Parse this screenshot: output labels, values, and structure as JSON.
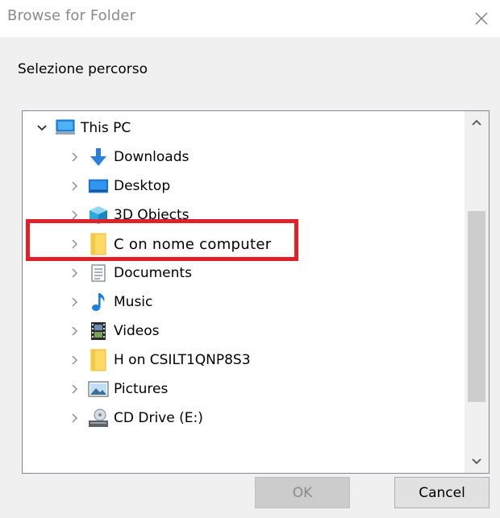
{
  "window": {
    "title": "Browse for Folder",
    "close_icon": "close-icon"
  },
  "dialog": {
    "instruction": "Selezione percorso"
  },
  "tree": {
    "root": {
      "label": "This PC",
      "icon": "computer-icon",
      "expanded": true
    },
    "items": [
      {
        "label": "Downloads",
        "icon": "downloads-arrow-icon"
      },
      {
        "label": "Desktop",
        "icon": "desktop-icon"
      },
      {
        "label": "3D Objects",
        "icon": "3d-objects-icon"
      },
      {
        "label": "C on nome computer",
        "icon": "folder-icon",
        "highlighted": true
      },
      {
        "label": "Documents",
        "icon": "documents-icon"
      },
      {
        "label": "Music",
        "icon": "music-note-icon"
      },
      {
        "label": "Videos",
        "icon": "videos-icon"
      },
      {
        "label": "H on CSILT1QNP8S3",
        "icon": "folder-icon"
      },
      {
        "label": "Pictures",
        "icon": "pictures-icon"
      },
      {
        "label": "CD Drive (E:)",
        "icon": "cd-drive-icon"
      }
    ]
  },
  "buttons": {
    "ok_label": "OK",
    "cancel_label": "Cancel"
  },
  "colors": {
    "highlight_border": "#e0202a",
    "scroll_thumb": "#cdcdcd",
    "dialog_background": "#f0f0f0"
  }
}
